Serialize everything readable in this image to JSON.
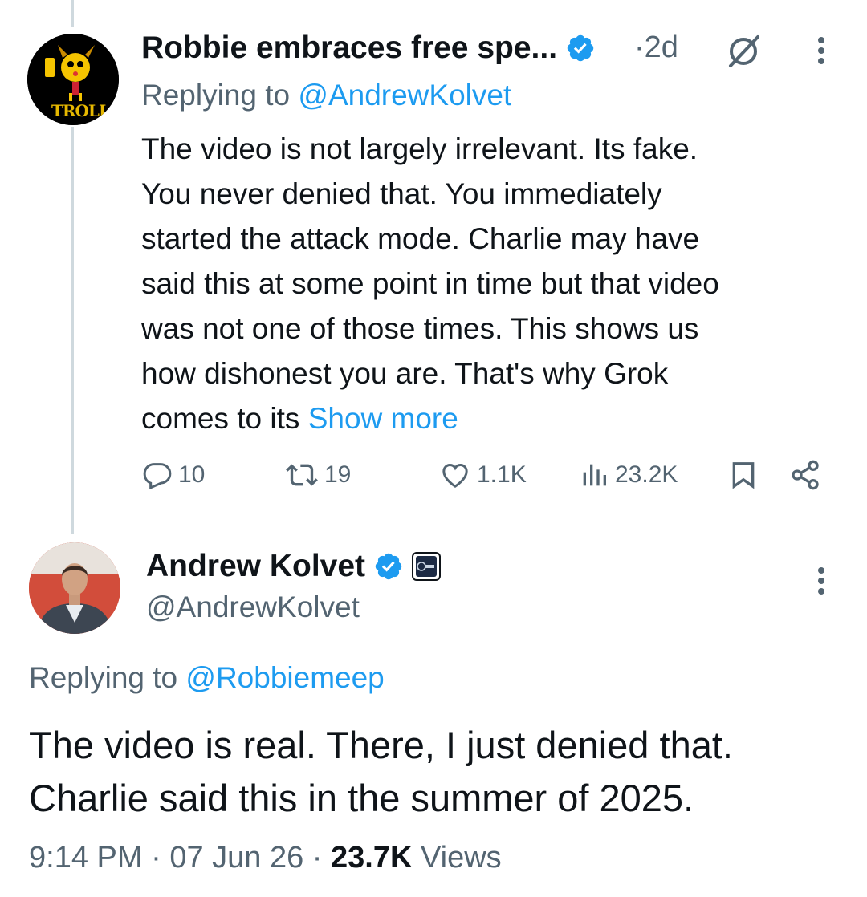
{
  "reply_tweet": {
    "display_name": "Robbie embraces free spe...",
    "separator": "·",
    "time": "2d",
    "replying_prefix": "Replying to ",
    "replying_handle": "@AndrewKolvet",
    "avatar_text": "TROLL",
    "body_lines": [
      "The video is not largely irrelevant.   Its fake.",
      "You never denied that.    You immediately",
      "started the attack mode.  Charlie may have",
      "said this at some point in time but that video",
      "was not one of those times.   This shows us",
      "how dishonest you are.   That's why Grok",
      "comes to its "
    ],
    "show_more": "Show more",
    "stats": {
      "replies": "10",
      "reposts": "19",
      "likes": "1.1K",
      "views": "23.2K"
    }
  },
  "main_tweet": {
    "display_name": "Andrew Kolvet",
    "handle": "@AndrewKolvet",
    "replying_prefix": "Replying to ",
    "replying_handle": "@Robbiemeep",
    "body_lines": [
      "The video is real. There, I just denied that.",
      "Charlie said this in the summer of 2025."
    ],
    "time": "9:14 PM",
    "sep1": " · ",
    "date": "07 Jun 26",
    "sep2": " · ",
    "views_count": "23.7K",
    "views_label": " Views"
  },
  "colors": {
    "accent": "#1d9bf0",
    "muted": "#536471",
    "text": "#0f1419",
    "line": "#cfd9de"
  }
}
